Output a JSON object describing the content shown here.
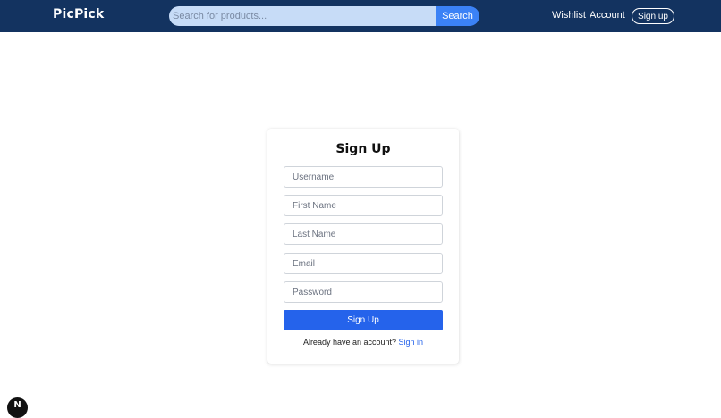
{
  "navbar": {
    "brand": "PicPick",
    "search_placeholder": "Search for products...",
    "search_button": "Search",
    "links": {
      "wishlist": "Wishlist",
      "account": "Account",
      "signup": "Sign up"
    },
    "background_color": "#133360",
    "search_button_color": "#3b82f6"
  },
  "form": {
    "title": "Sign Up",
    "fields": {
      "username": "Username",
      "first_name": "First Name",
      "last_name": "Last Name",
      "email": "Email",
      "password": "Password"
    },
    "submit_label": "Sign Up",
    "footer_text": "Already have an account?",
    "signin_link": "Sign in",
    "accent_color": "#2563eb"
  },
  "dev_badge": {
    "letter": "N",
    "icon": "nextjs-logo-icon"
  }
}
